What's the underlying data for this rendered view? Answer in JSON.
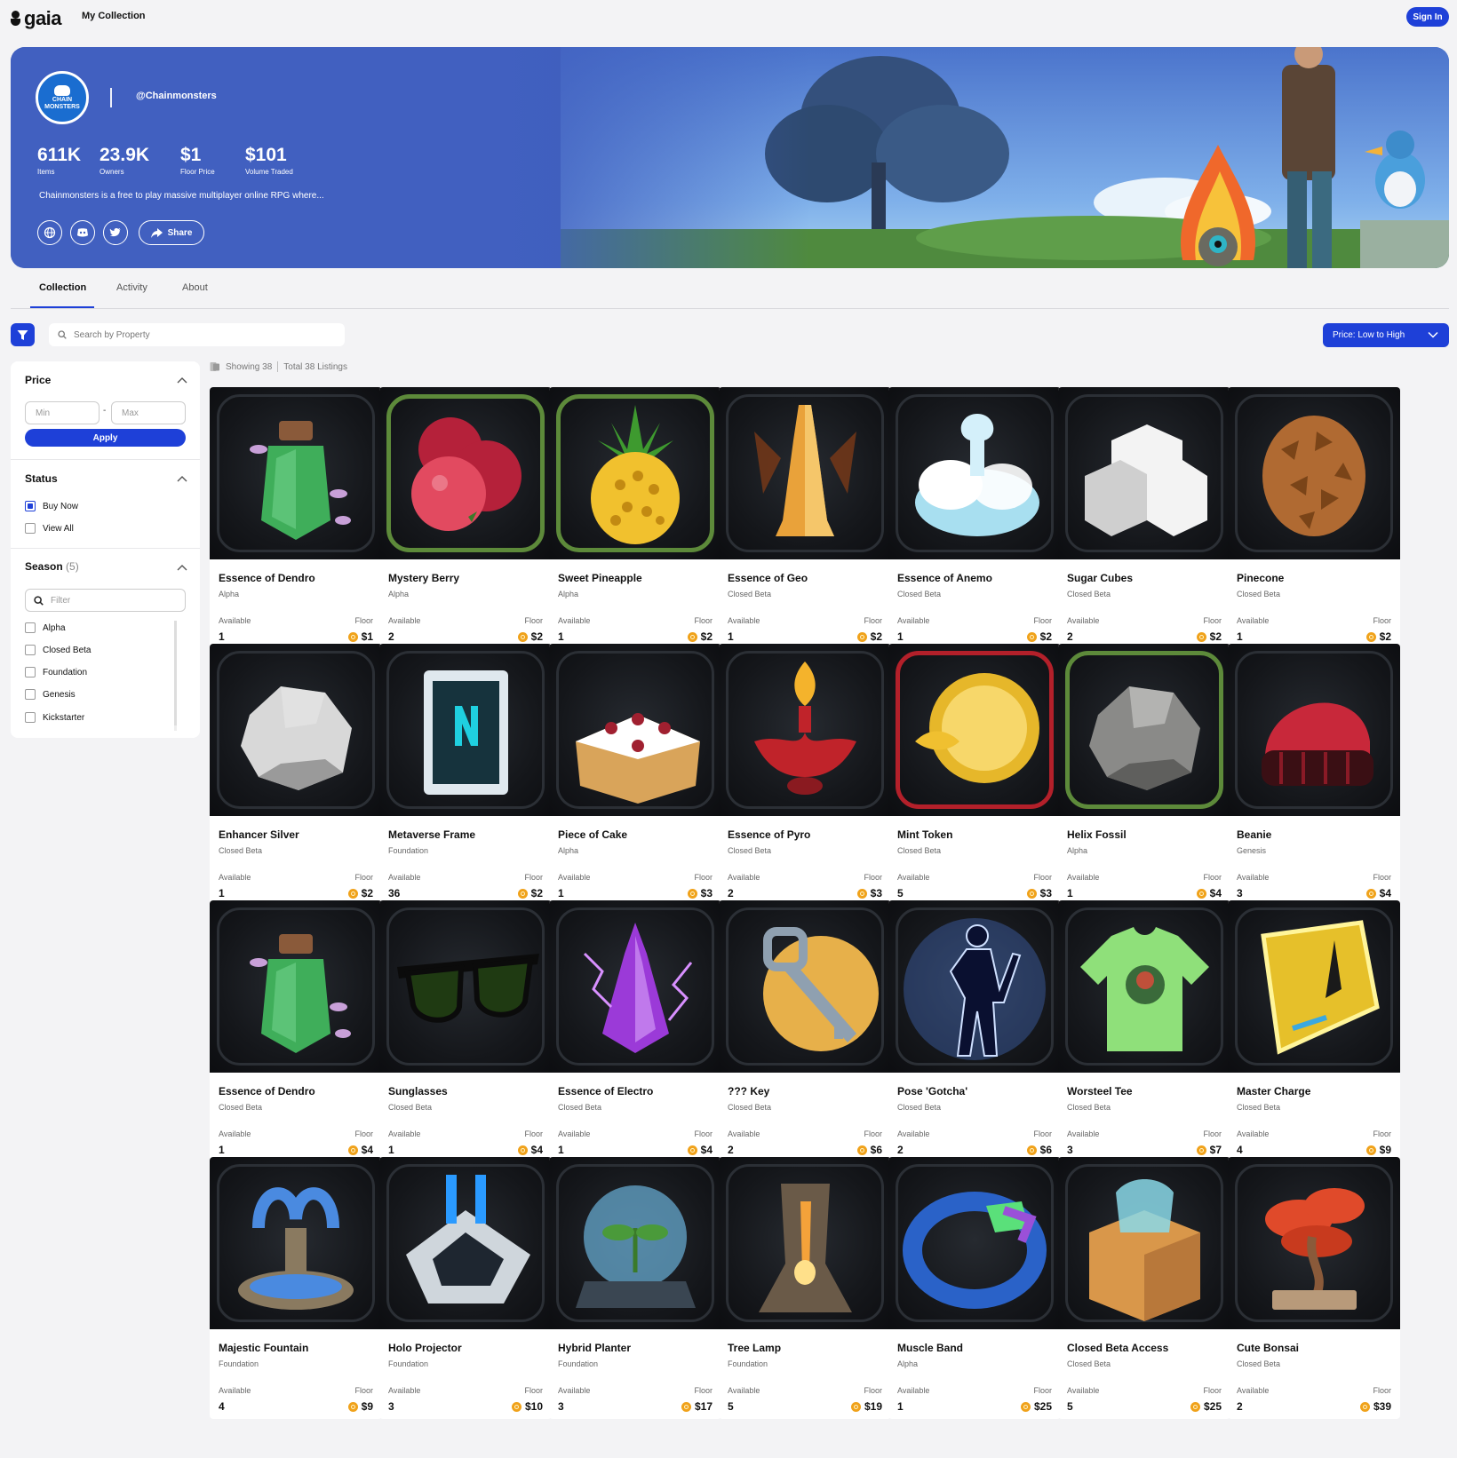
{
  "nav": {
    "logo_text": "gaia",
    "my_collection": "My Collection",
    "sign_in": "Sign In"
  },
  "profile": {
    "avatar_text": "CHAIN MONSTERS",
    "handle": "@Chainmonsters",
    "stats": [
      {
        "value": "611K",
        "label": "Items"
      },
      {
        "value": "23.9K",
        "label": "Owners"
      },
      {
        "value": "$1",
        "label": "Floor Price"
      },
      {
        "value": "$101",
        "label": "Volume Traded"
      }
    ],
    "description": "Chainmonsters is a free to play massive multiplayer online RPG where...",
    "share_label": "Share",
    "social_icons": [
      "globe-icon",
      "discord-icon",
      "twitter-icon"
    ]
  },
  "tabs": [
    "Collection",
    "Activity",
    "About"
  ],
  "toolbar": {
    "search_placeholder": "Search by Property",
    "sort_label": "Price: Low to High"
  },
  "sidebar": {
    "price": {
      "title": "Price",
      "min_placeholder": "Min",
      "max_placeholder": "Max",
      "dash": "-",
      "apply": "Apply"
    },
    "status": {
      "title": "Status",
      "options": [
        {
          "label": "Buy Now",
          "checked": true
        },
        {
          "label": "View All",
          "checked": false
        }
      ]
    },
    "season": {
      "title": "Season",
      "count": "(5)",
      "filter_placeholder": "Filter",
      "options": [
        "Alpha",
        "Closed Beta",
        "Foundation",
        "Genesis",
        "Kickstarter"
      ]
    }
  },
  "listing": {
    "showing": "Showing 38",
    "total": "Total 38 Listings"
  },
  "labels": {
    "available": "Available",
    "floor": "Floor"
  },
  "colors": {
    "accent": "#1e40d8",
    "coin": "#f0a21b",
    "banner": "#4160c0"
  },
  "cards": [
    {
      "name": "Essence of Dendro",
      "season": "Alpha",
      "available": "1",
      "floor": "$1",
      "icon": "potion-green-icon"
    },
    {
      "name": "Mystery Berry",
      "season": "Alpha",
      "available": "2",
      "floor": "$2",
      "icon": "berry-icon"
    },
    {
      "name": "Sweet Pineapple",
      "season": "Alpha",
      "available": "1",
      "floor": "$2",
      "icon": "pineapple-icon"
    },
    {
      "name": "Essence of Geo",
      "season": "Closed Beta",
      "available": "1",
      "floor": "$2",
      "icon": "geo-crystal-icon"
    },
    {
      "name": "Essence of Anemo",
      "season": "Closed Beta",
      "available": "1",
      "floor": "$2",
      "icon": "wind-flask-icon"
    },
    {
      "name": "Sugar Cubes",
      "season": "Closed Beta",
      "available": "2",
      "floor": "$2",
      "icon": "sugar-cubes-icon"
    },
    {
      "name": "Pinecone",
      "season": "Closed Beta",
      "available": "1",
      "floor": "$2",
      "icon": "pinecone-icon"
    },
    {
      "name": "Enhancer Silver",
      "season": "Closed Beta",
      "available": "1",
      "floor": "$2",
      "icon": "silver-ore-icon"
    },
    {
      "name": "Metaverse Frame",
      "season": "Foundation",
      "available": "36",
      "floor": "$2",
      "icon": "frame-icon"
    },
    {
      "name": "Piece of Cake",
      "season": "Alpha",
      "available": "1",
      "floor": "$3",
      "icon": "cake-icon"
    },
    {
      "name": "Essence of Pyro",
      "season": "Closed Beta",
      "available": "2",
      "floor": "$3",
      "icon": "fire-lamp-icon"
    },
    {
      "name": "Mint Token",
      "season": "Closed Beta",
      "available": "5",
      "floor": "$3",
      "icon": "gold-coin-icon"
    },
    {
      "name": "Helix Fossil",
      "season": "Alpha",
      "available": "1",
      "floor": "$4",
      "icon": "fossil-icon"
    },
    {
      "name": "Beanie",
      "season": "Genesis",
      "available": "3",
      "floor": "$4",
      "icon": "beanie-icon"
    },
    {
      "name": "Essence of Dendro",
      "season": "Closed Beta",
      "available": "1",
      "floor": "$4",
      "icon": "potion-green-icon"
    },
    {
      "name": "Sunglasses",
      "season": "Closed Beta",
      "available": "1",
      "floor": "$4",
      "icon": "sunglasses-icon"
    },
    {
      "name": "Essence of Electro",
      "season": "Closed Beta",
      "available": "1",
      "floor": "$4",
      "icon": "electro-flask-icon"
    },
    {
      "name": "??? Key",
      "season": "Closed Beta",
      "available": "2",
      "floor": "$6",
      "icon": "key-icon"
    },
    {
      "name": "Pose 'Gotcha'",
      "season": "Closed Beta",
      "available": "2",
      "floor": "$6",
      "icon": "pose-silhouette-icon"
    },
    {
      "name": "Worsteel Tee",
      "season": "Closed Beta",
      "available": "3",
      "floor": "$7",
      "icon": "tshirt-icon"
    },
    {
      "name": "Master Charge",
      "season": "Closed Beta",
      "available": "4",
      "floor": "$9",
      "icon": "battery-icon"
    },
    {
      "name": "Majestic Fountain",
      "season": "Foundation",
      "available": "4",
      "floor": "$9",
      "icon": "fountain-icon"
    },
    {
      "name": "Holo Projector",
      "season": "Foundation",
      "available": "3",
      "floor": "$10",
      "icon": "projector-icon"
    },
    {
      "name": "Hybrid Planter",
      "season": "Foundation",
      "available": "3",
      "floor": "$17",
      "icon": "planter-icon"
    },
    {
      "name": "Tree Lamp",
      "season": "Foundation",
      "available": "5",
      "floor": "$19",
      "icon": "tree-lamp-icon"
    },
    {
      "name": "Muscle Band",
      "season": "Alpha",
      "available": "1",
      "floor": "$25",
      "icon": "band-icon"
    },
    {
      "name": "Closed Beta Access",
      "season": "Closed Beta",
      "available": "5",
      "floor": "$25",
      "icon": "beta-box-icon"
    },
    {
      "name": "Cute Bonsai",
      "season": "Closed Beta",
      "available": "2",
      "floor": "$39",
      "icon": "bonsai-icon"
    }
  ]
}
